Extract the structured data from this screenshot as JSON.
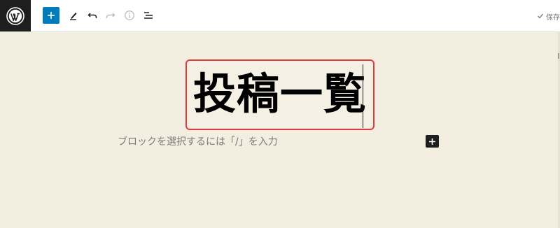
{
  "toolbar": {
    "logo_icon": "wordpress-logo-icon",
    "add_block_icon": "plus-icon",
    "tools_icon": "pencil-icon",
    "undo_icon": "undo-icon",
    "redo_icon": "redo-icon",
    "details_icon": "info-icon",
    "list_view_icon": "list-view-icon",
    "saved_icon": "check-icon",
    "saved_label": "保存"
  },
  "editor": {
    "title": "投稿一覧",
    "block_placeholder": "ブロックを選択するには「/」を入力",
    "inserter_icon": "plus-icon"
  },
  "colors": {
    "canvas_background": "#f4eee0",
    "accent": "#007cba",
    "highlight_border": "#e03a3a",
    "dark": "#1e1e1e"
  }
}
